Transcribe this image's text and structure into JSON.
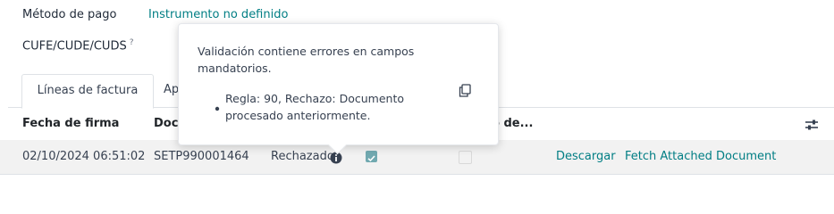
{
  "form": {
    "payment_method_label": "Método de pago",
    "payment_method_value": "Instrumento no definido",
    "cufe_label": "CUFE/CUDE/CUDS",
    "cufe_help": "?"
  },
  "tabs": [
    {
      "label": "Líneas de factura"
    },
    {
      "label": "Apu"
    }
  ],
  "table": {
    "headers": [
      "Fecha de firma",
      "Docu",
      "o de..."
    ],
    "row": {
      "date": "02/10/2024 06:51:02",
      "document": "SETP990001464",
      "status": "Rechazado",
      "checked": true,
      "download_label": "Descargar",
      "fetch_label": "Fetch Attached Document"
    }
  },
  "popover": {
    "message": "Validación contiene errores en campos mandatorios.",
    "errors": [
      "Regla: 90, Rechazo: Documento procesado anteriormente."
    ]
  },
  "colors": {
    "accent": "#017e84",
    "checkbox": "#71a9b0"
  }
}
